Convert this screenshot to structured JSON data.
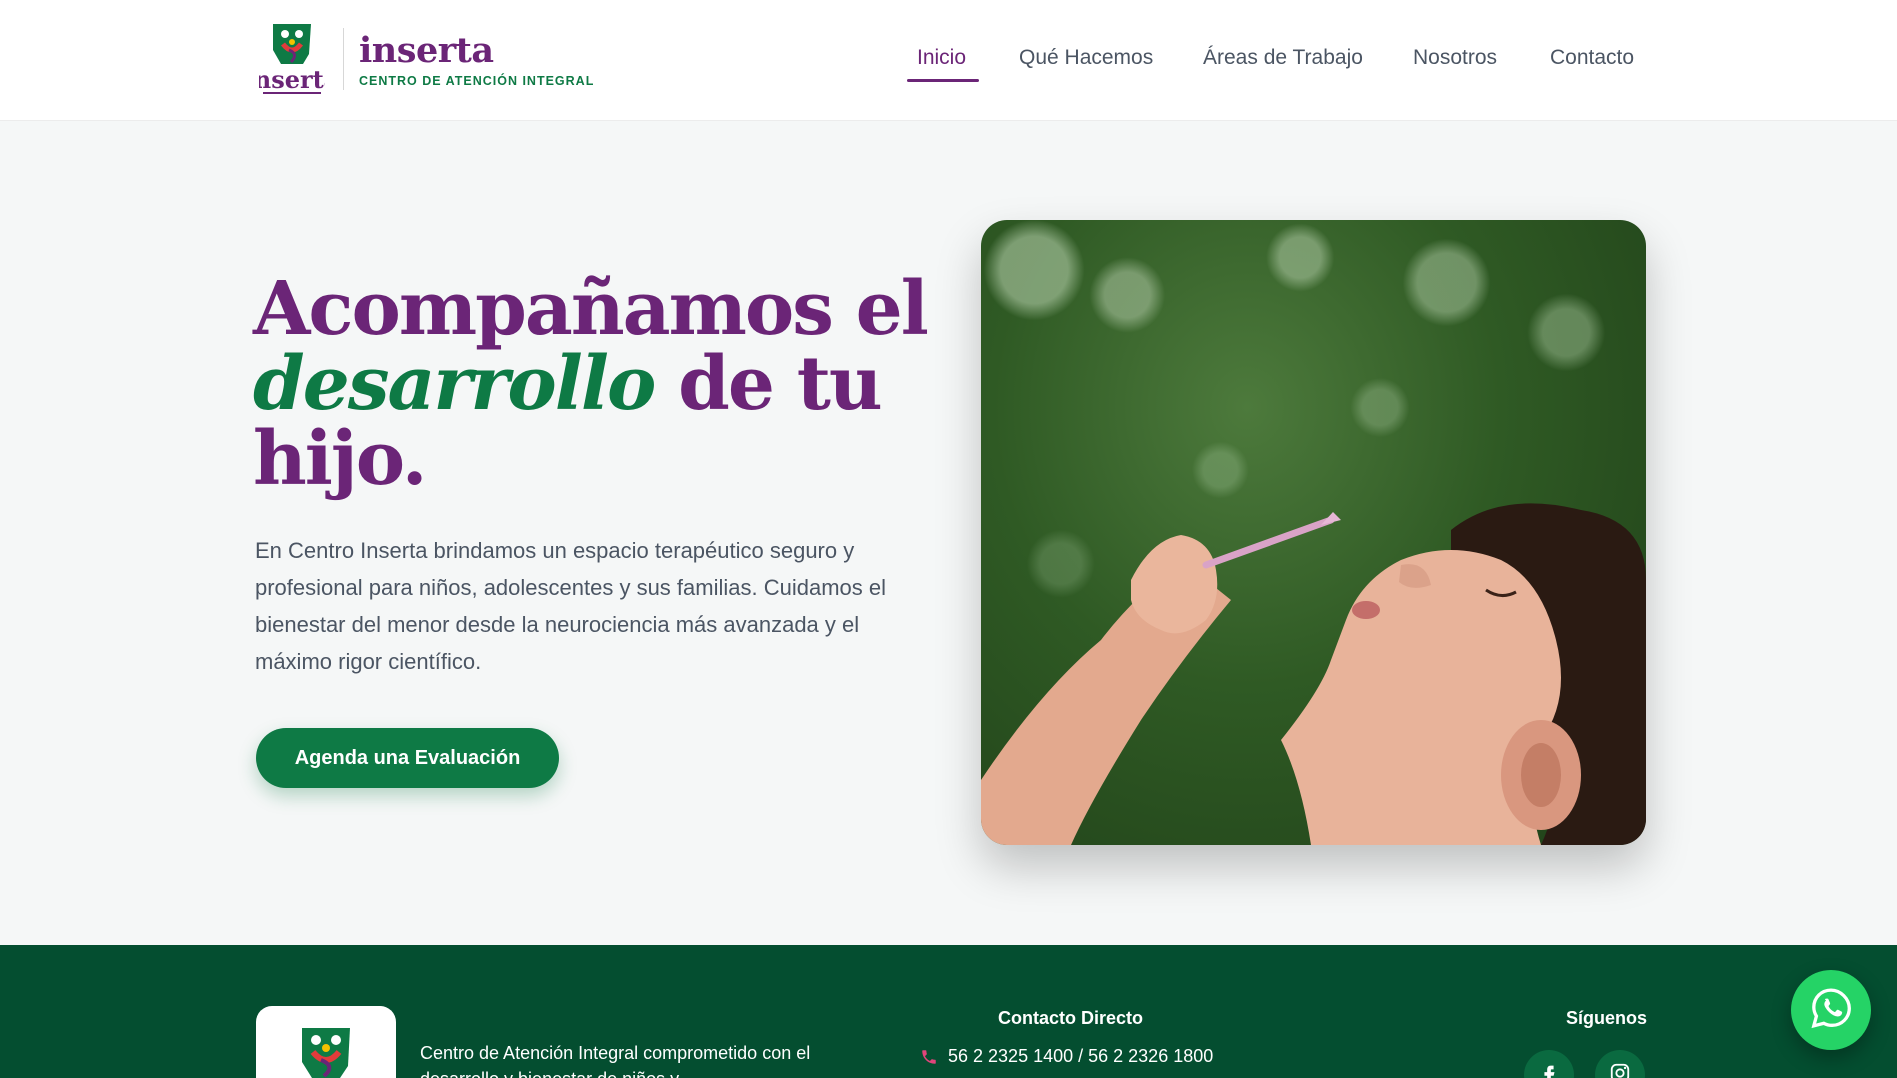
{
  "header": {
    "brand_name": "inserta",
    "brand_tagline": "CENTRO DE ATENCIÓN INTEGRAL",
    "logo_text": "inserta"
  },
  "nav": {
    "items": [
      {
        "label": "Inicio",
        "active": true
      },
      {
        "label": "Qué Hacemos",
        "active": false
      },
      {
        "label": "Áreas de Trabajo",
        "active": false
      },
      {
        "label": "Nosotros",
        "active": false
      },
      {
        "label": "Contacto",
        "active": false
      }
    ]
  },
  "hero": {
    "title_part1": "Acompañamos el",
    "title_emphasis": "desarrollo",
    "title_part2": " de tu",
    "title_part3": "hijo.",
    "description": "En Centro Inserta brindamos un espacio terapéutico seguro y profesional para niños, adolescentes y sus familias. Cuidamos el bienestar del menor desde la neurociencia más avanzada y el máximo rigor científico.",
    "cta_label": "Agenda una Evaluación"
  },
  "footer": {
    "description": "Centro de Atención Integral comprometido con el desarrollo y bienestar de niños y",
    "contact_title": "Contacto Directo",
    "phone": "56 2 2325 1400 / 56 2 2326 1800",
    "social_title": "Síguenos"
  },
  "colors": {
    "brand_purple": "#6b2577",
    "brand_green": "#0e7a45",
    "footer_green": "#044e30",
    "whatsapp_green": "#25d366"
  },
  "icons": {
    "whatsapp": "whatsapp-icon",
    "phone": "phone-icon",
    "facebook": "facebook-icon",
    "instagram": "instagram-icon"
  }
}
